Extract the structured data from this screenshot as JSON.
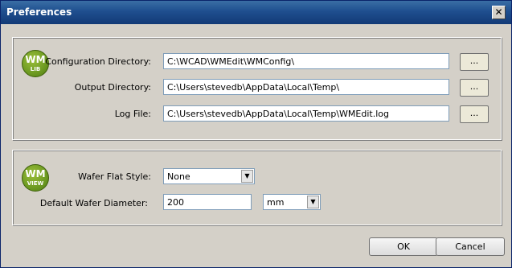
{
  "window": {
    "title": "Preferences",
    "close_symbol": "✕"
  },
  "lib_group": {
    "badge": {
      "top": "WM",
      "bottom": "LIB"
    },
    "config_dir": {
      "label": "Configuration Directory:",
      "value": "C:\\WCAD\\WMEdit\\WMConfig\\",
      "browse": "..."
    },
    "output_dir": {
      "label": "Output Directory:",
      "value": "C:\\Users\\stevedb\\AppData\\Local\\Temp\\",
      "browse": "..."
    },
    "log_file": {
      "label": "Log File:",
      "value": "C:\\Users\\stevedb\\AppData\\Local\\Temp\\WMEdit.log",
      "browse": "..."
    }
  },
  "view_group": {
    "badge": {
      "top": "WM",
      "bottom": "VIEW"
    },
    "flat_style": {
      "label": "Wafer Flat Style:",
      "value": "None"
    },
    "diameter": {
      "label": "Default Wafer Diameter:",
      "value": "200",
      "unit": "mm"
    }
  },
  "buttons": {
    "ok": "OK",
    "cancel": "Cancel"
  },
  "icons": {
    "badge": "wm-badge-icon",
    "dropdown": "chevron-down-icon",
    "close": "close-icon"
  },
  "colors": {
    "titlebar": "#1f4f8f",
    "badge": "#6d9a22"
  }
}
